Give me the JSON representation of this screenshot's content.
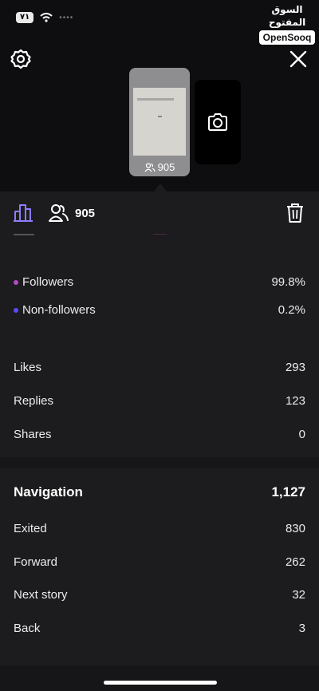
{
  "status": {
    "battery": "٧١"
  },
  "watermark": {
    "arabic": "السوق المفتوح",
    "english": "OpenSooq"
  },
  "story": {
    "viewer_count": "905"
  },
  "tabs": {
    "viewers_count": "905"
  },
  "audience": [
    {
      "label": "Followers",
      "value": "99.8%",
      "color": "#b549c9"
    },
    {
      "label": "Non-followers",
      "value": "0.2%",
      "color": "#5b4bff"
    }
  ],
  "interactions": [
    {
      "label": "Likes",
      "value": "293"
    },
    {
      "label": "Replies",
      "value": "123"
    },
    {
      "label": "Shares",
      "value": "0"
    }
  ],
  "navigation": {
    "title": "Navigation",
    "total": "1,127",
    "items": [
      {
        "label": "Exited",
        "value": "830"
      },
      {
        "label": "Forward",
        "value": "262"
      },
      {
        "label": "Next story",
        "value": "32"
      },
      {
        "label": "Back",
        "value": "3"
      }
    ]
  },
  "icons": {
    "settings": "gear-icon",
    "close": "close-icon",
    "camera": "camera-icon",
    "chart": "bar-chart-icon",
    "viewers": "people-icon",
    "delete": "trash-icon"
  },
  "colors": {
    "accent_tab": "#8e7cff",
    "followers_dot": "#b549c9",
    "nonfollowers_dot": "#5b4bff"
  }
}
